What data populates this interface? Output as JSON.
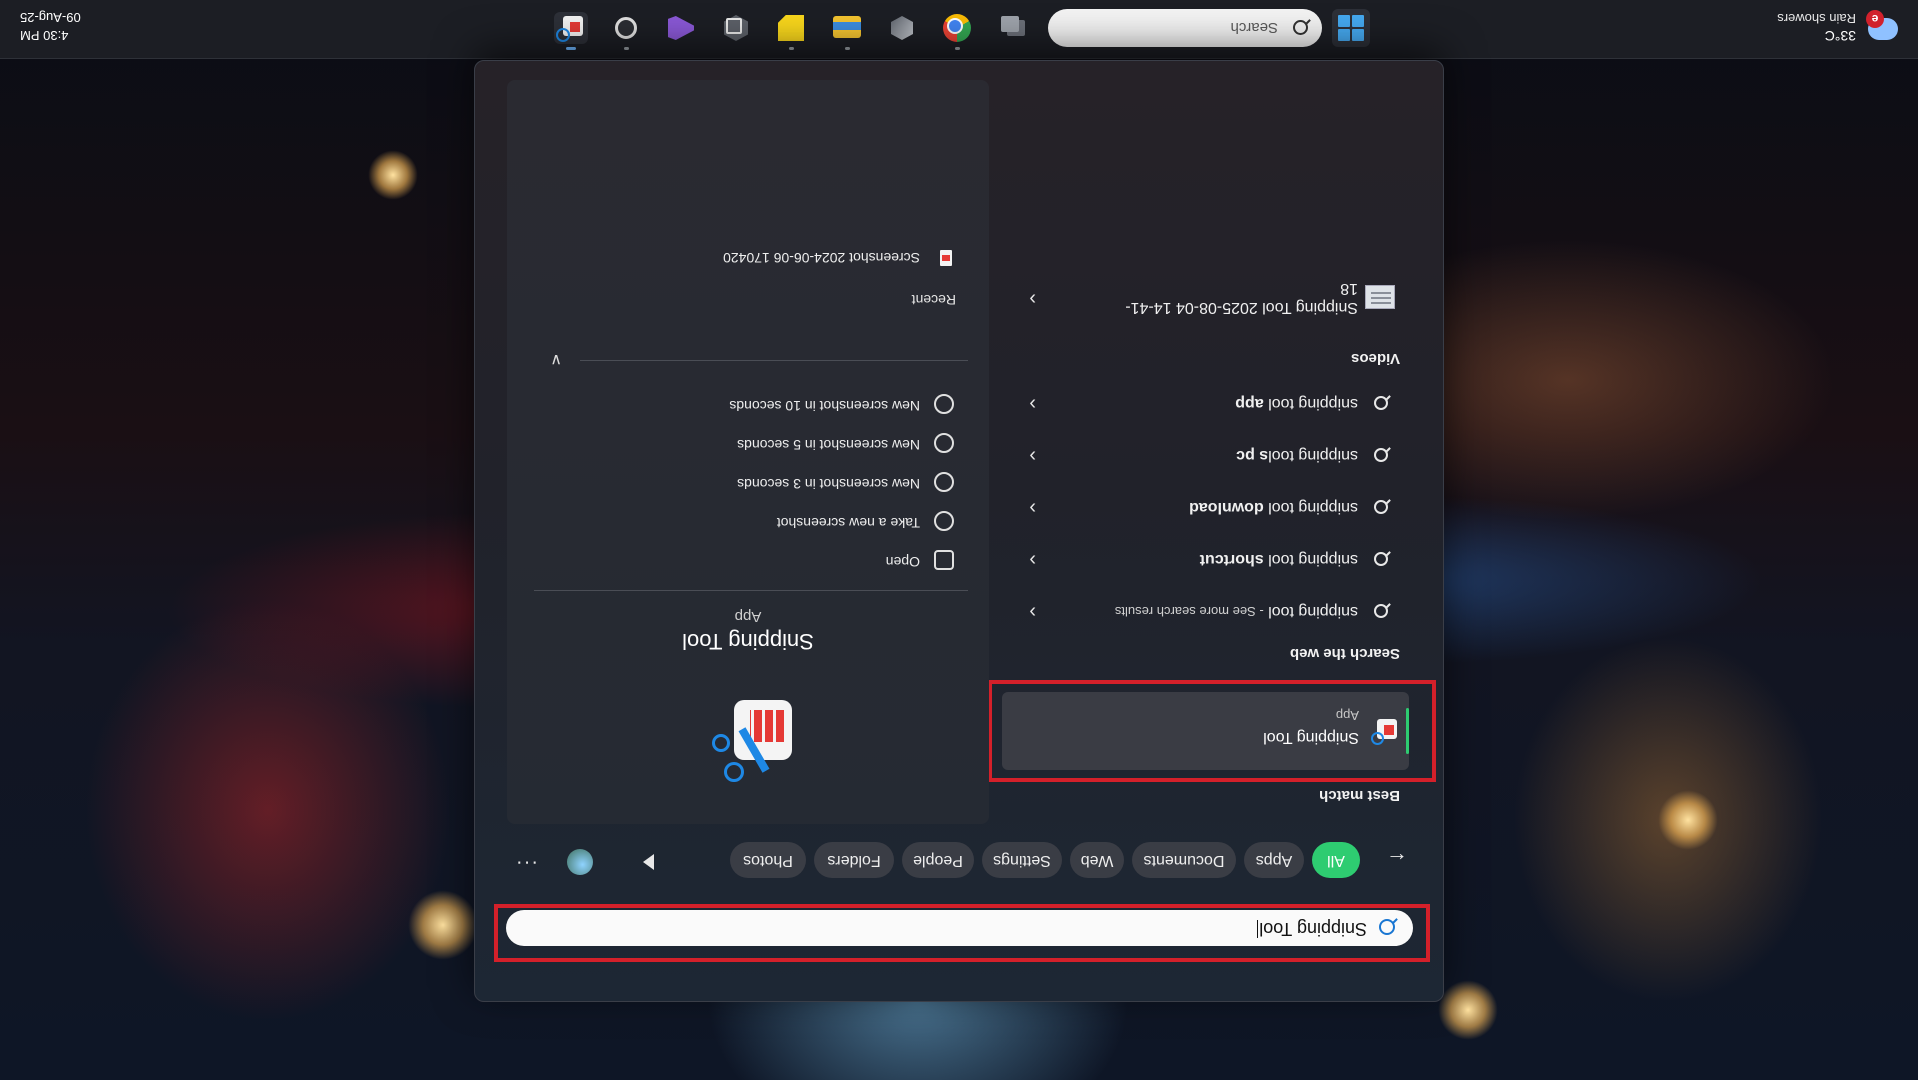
{
  "taskbar": {
    "weather": {
      "temp": "33°C",
      "desc": "Rain showers",
      "badge": "e"
    },
    "search_placeholder": "Search",
    "clock": {
      "time": "4:30 PM",
      "date": "09-Aug-25"
    },
    "apps": [
      "task-view-icon",
      "chrome-icon",
      "cube-app-icon",
      "file-explorer-icon",
      "sticky-notes-icon",
      "unity-hub-icon",
      "visual-studio-icon",
      "settings-gear-app-icon",
      "snipping-tool-icon"
    ]
  },
  "search": {
    "query": "Snipping Tool"
  },
  "filters": [
    "All",
    "Apps",
    "Documents",
    "Web",
    "Settings",
    "People",
    "Folders",
    "Photos"
  ],
  "best_match": {
    "title": "Best match",
    "name": "Snipping Tool",
    "type": "App"
  },
  "web": {
    "title": "Search the web",
    "items": [
      {
        "prefix": "snipping tool",
        "suffix": "- See more search results",
        "bold": false
      },
      {
        "prefix": "snipping tool ",
        "suffix": "shortcut",
        "bold": true
      },
      {
        "prefix": "snipping tool ",
        "suffix": "download",
        "bold": true
      },
      {
        "prefix": "snipping tool",
        "suffix": "s pc",
        "bold": true
      },
      {
        "prefix": "snipping tool ",
        "suffix": "app",
        "bold": true
      }
    ]
  },
  "videos": {
    "title": "Videos",
    "item_line1": "Snipping Tool 2025-08-04 14-41-",
    "item_line2": "18"
  },
  "detail": {
    "name": "Snipping Tool",
    "type": "App",
    "actions": [
      "Open",
      "Take a new screenshot",
      "New screenshot in 3 seconds",
      "New screenshot in 5 seconds",
      "New screenshot in 10 seconds"
    ],
    "recent_title": "Recent",
    "recent_items": [
      "Screenshot 2024-06-06 170420"
    ]
  },
  "colors": {
    "accent_green": "#2ecc71",
    "highlight_red": "#d4202a",
    "search_icon_blue": "#1976d2"
  }
}
